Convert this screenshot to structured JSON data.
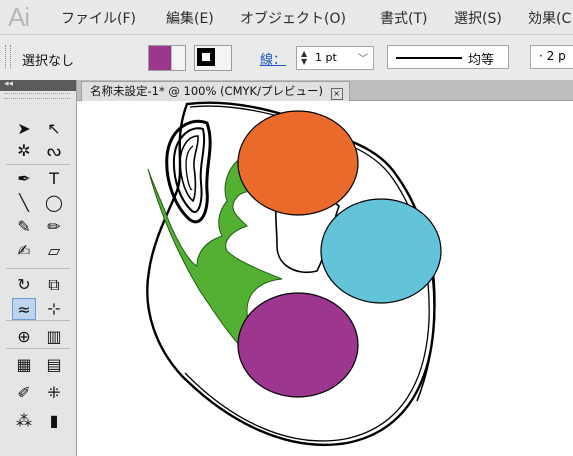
{
  "app": {
    "logo": "Ai"
  },
  "menu": [
    "ファイル(F)",
    "編集(E)",
    "オブジェクト(O)",
    "書式(T)",
    "選択(S)",
    "効果(C"
  ],
  "control_bar": {
    "selection_label": "選択なし",
    "fill_color": "#9c368e",
    "stroke_color": "#000000",
    "stroke_label": "線：",
    "stroke_weight": "1 pt",
    "profile_label": "均等",
    "brush_value": "· 2 p"
  },
  "toolbox": {
    "collapse_glyph": "◂◂",
    "tools": [
      {
        "name": "selection-tool-icon",
        "glyph": "➤"
      },
      {
        "name": "direct-selection-tool-icon",
        "glyph": "↖"
      },
      {
        "name": "magic-wand-tool-icon",
        "glyph": "✲"
      },
      {
        "name": "lasso-tool-icon",
        "glyph": "ᔓ"
      },
      {
        "name": "pen-tool-icon",
        "glyph": "✒"
      },
      {
        "name": "type-tool-icon",
        "glyph": "T"
      },
      {
        "name": "line-segment-tool-icon",
        "glyph": "╲"
      },
      {
        "name": "ellipse-tool-icon",
        "glyph": "◯"
      },
      {
        "name": "paintbrush-tool-icon",
        "glyph": "✎"
      },
      {
        "name": "pencil-tool-icon",
        "glyph": "✏"
      },
      {
        "name": "blob-brush-tool-icon",
        "glyph": "✍"
      },
      {
        "name": "eraser-tool-icon",
        "glyph": "▱"
      },
      {
        "name": "rotate-tool-icon",
        "glyph": "↻"
      },
      {
        "name": "scale-tool-icon",
        "glyph": "⧉"
      },
      {
        "name": "width-tool-icon",
        "glyph": "≈"
      },
      {
        "name": "free-transform-tool-icon",
        "glyph": "⊹"
      },
      {
        "name": "shape-builder-tool-icon",
        "glyph": "⊕"
      },
      {
        "name": "perspective-grid-tool-icon",
        "glyph": "▥"
      },
      {
        "name": "mesh-tool-icon",
        "glyph": "▦"
      },
      {
        "name": "gradient-tool-icon",
        "glyph": "▤"
      },
      {
        "name": "eyedropper-tool-icon",
        "glyph": "✐"
      },
      {
        "name": "blend-tool-icon",
        "glyph": "⁜"
      },
      {
        "name": "symbol-sprayer-tool-icon",
        "glyph": "⁂"
      },
      {
        "name": "column-graph-tool-icon",
        "glyph": "▮"
      }
    ]
  },
  "document": {
    "tab_title": "名称未設定-1* @ 100% (CMYK/プレビュー)",
    "close_glyph": "×"
  },
  "artwork": {
    "orange_circle": "#e96a2b",
    "blue_circle": "#63c3d8",
    "purple_circle": "#9c368e",
    "green_shape": "#54b032"
  }
}
